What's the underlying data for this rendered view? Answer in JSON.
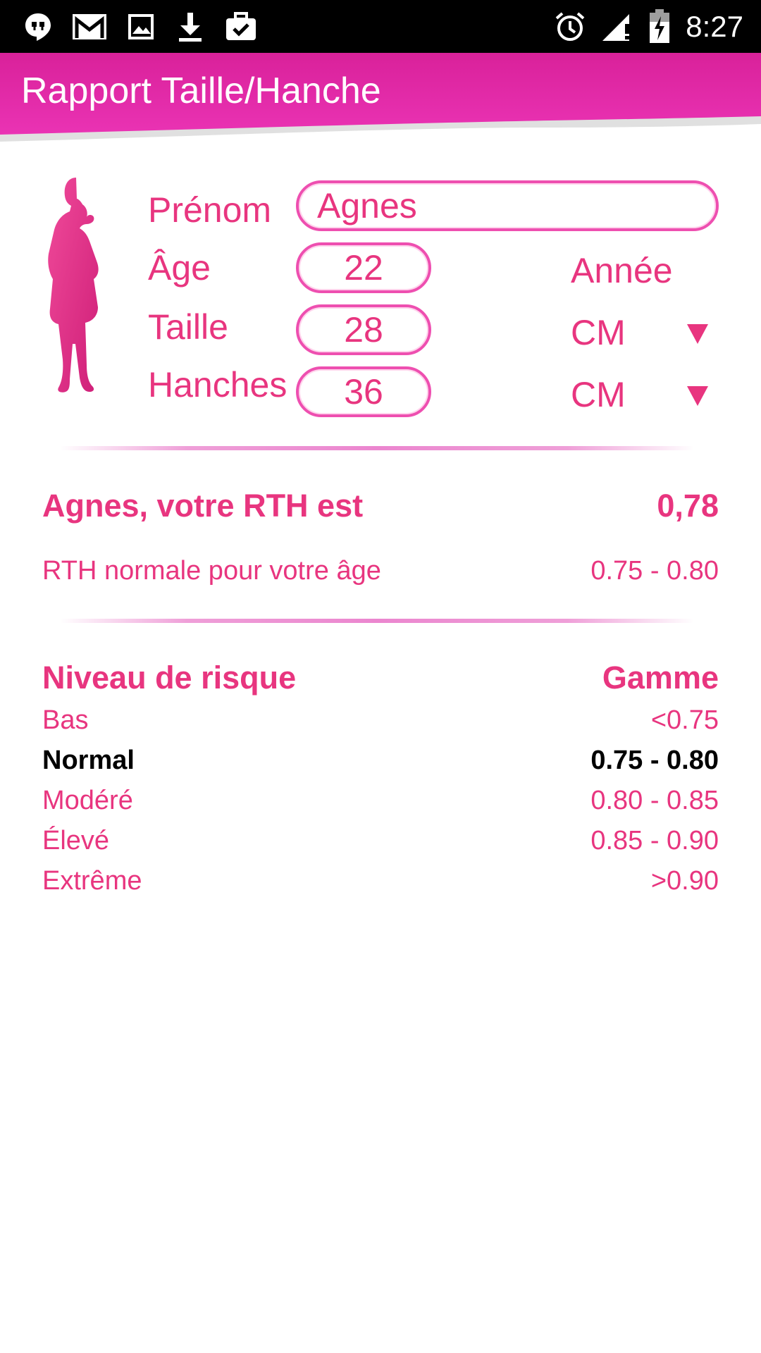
{
  "status_bar": {
    "time": "8:27",
    "left_icons": [
      "hangouts-icon",
      "gmail-icon",
      "image-icon",
      "download-icon",
      "briefcase-check-icon"
    ],
    "right_icons": [
      "alarm-icon",
      "signal-icon",
      "battery-charging-icon"
    ]
  },
  "app_bar": {
    "title": "Rapport Taille/Hanche",
    "color": "#e0269e"
  },
  "form": {
    "prenom_label": "Prénom",
    "prenom_value": "Agnes",
    "age_label": "Âge",
    "age_value": "22",
    "age_unit": "Année",
    "taille_label": "Taille",
    "taille_value": "28",
    "taille_unit": "CM",
    "hanches_label": "Hanches",
    "hanches_value": "36",
    "hanches_unit": "CM"
  },
  "result": {
    "headline": "Agnes, votre RTH est",
    "value": "0,78",
    "normal_label": "RTH normale pour votre âge",
    "normal_range": "0.75 - 0.80"
  },
  "risk_table": {
    "header_left": "Niveau de risque",
    "header_right": "Gamme",
    "rows": [
      {
        "level": "Bas",
        "range": "<0.75"
      },
      {
        "level": "Normal",
        "range": "0.75 - 0.80"
      },
      {
        "level": "Modéré",
        "range": "0.80 - 0.85"
      },
      {
        "level": "Élevé",
        "range": "0.85 - 0.90"
      },
      {
        "level": "Extrême",
        "range": ">0.90"
      }
    ],
    "highlighted_row": "Normal"
  },
  "colors": {
    "accent": "#e8357f",
    "field_border": "#ee4fb0",
    "status_bar": "#000000"
  }
}
